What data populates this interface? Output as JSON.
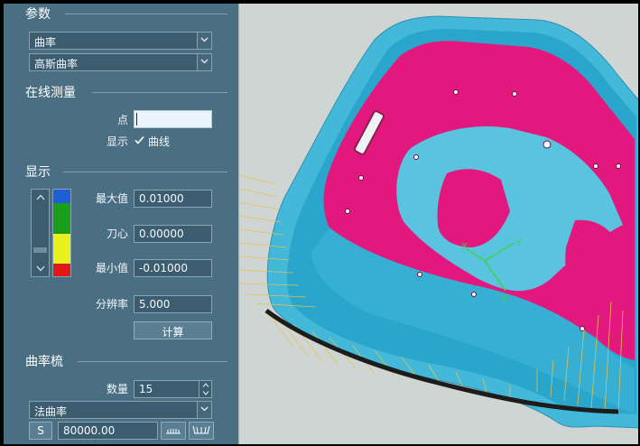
{
  "params": {
    "title": "参数",
    "dropdown1": "曲率",
    "dropdown2": "高斯曲率"
  },
  "online": {
    "title": "在线测量",
    "point_label": "点",
    "point_value": "",
    "display_label": "显示",
    "curve_checkbox_label": "曲线",
    "curve_checked": true
  },
  "display": {
    "title": "显示",
    "max_label": "最大值",
    "max_value": "0.01000",
    "center_label": "刀心",
    "center_value": "0.00000",
    "min_label": "最小值",
    "min_value": "-0.01000",
    "resolution_label": "分辨率",
    "resolution_value": "5.000",
    "compute_button": "计算",
    "color_scale": [
      "#1e5fd8",
      "#1a9d1a",
      "#e8f020",
      "#e01818"
    ]
  },
  "comb": {
    "title": "曲率梳",
    "count_label": "数量",
    "count_value": "15",
    "type_dropdown": "法曲率",
    "scale_button": "S",
    "scale_value": "80000.00"
  },
  "colors": {
    "panel_bg": "#4a6f83",
    "surface_cyan": "#3fb6d6",
    "surface_magenta": "#e0167c",
    "comb_yellow": "#e6c34a"
  }
}
